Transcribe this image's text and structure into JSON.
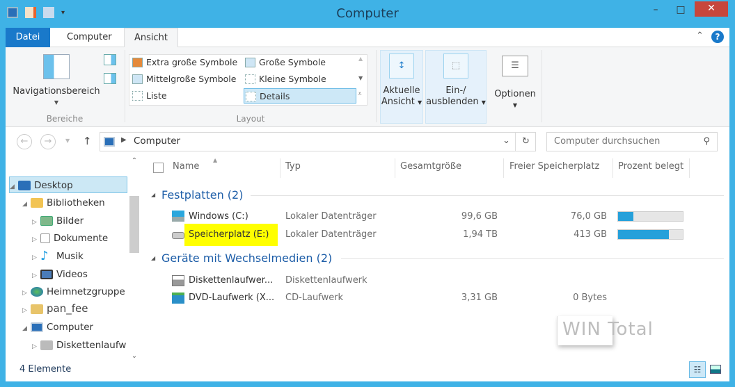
{
  "window": {
    "title": "Computer"
  },
  "ribbon_tabs": [
    {
      "label": "Datei"
    },
    {
      "label": "Computer"
    },
    {
      "label": "Ansicht"
    }
  ],
  "ribbon": {
    "bereiche": {
      "button": "Navigationsbereich",
      "label": "Bereiche"
    },
    "layout": {
      "label": "Layout",
      "items": [
        "Extra große Symbole",
        "Große Symbole",
        "Mittelgroße Symbole",
        "Kleine Symbole",
        "Liste",
        "Details"
      ],
      "selected": "Details"
    },
    "aktuelle_ansicht": [
      "Aktuelle",
      "Ansicht"
    ],
    "ein_ausblenden": [
      "Ein-/",
      "ausblenden"
    ],
    "optionen": "Optionen"
  },
  "address": {
    "path": "Computer"
  },
  "search": {
    "placeholder": "Computer durchsuchen"
  },
  "nav_tree": [
    {
      "label": "Desktop",
      "selected": true
    },
    {
      "label": "Bibliotheken"
    },
    {
      "label": "Bilder"
    },
    {
      "label": "Dokumente"
    },
    {
      "label": "Musik"
    },
    {
      "label": "Videos"
    },
    {
      "label": "Heimnetzgruppe"
    },
    {
      "label": "pan_fee"
    },
    {
      "label": "Computer"
    },
    {
      "label": "Diskettenlaufw"
    }
  ],
  "columns": [
    "Name",
    "Typ",
    "Gesamtgröße",
    "Freier Speicherplatz",
    "Prozent belegt"
  ],
  "groups": [
    {
      "title": "Festplatten (2)",
      "items": [
        {
          "name": "Windows (C:)",
          "type": "Lokaler Datenträger",
          "total": "99,6 GB",
          "free": "76,0 GB",
          "percent_used": 24
        },
        {
          "name": "Speicherplatz (E:)",
          "type": "Lokaler Datenträger",
          "total": "1,94 TB",
          "free": "413 GB",
          "percent_used": 79,
          "highlighted": true
        }
      ]
    },
    {
      "title": "Geräte mit Wechselmedien (2)",
      "items": [
        {
          "name": "Diskettenlaufwer...",
          "type": "Diskettenlaufwerk",
          "total": "",
          "free": ""
        },
        {
          "name": "DVD-Laufwerk (X...",
          "type": "CD-Laufwerk",
          "total": "3,31 GB",
          "free": "0 Bytes"
        }
      ]
    }
  ],
  "watermark": "WIN Total",
  "status": {
    "count": "4 Elemente"
  },
  "colors": {
    "accent": "#3fb2e6",
    "bar": "#26a0da",
    "highlight": "#ffff00"
  }
}
